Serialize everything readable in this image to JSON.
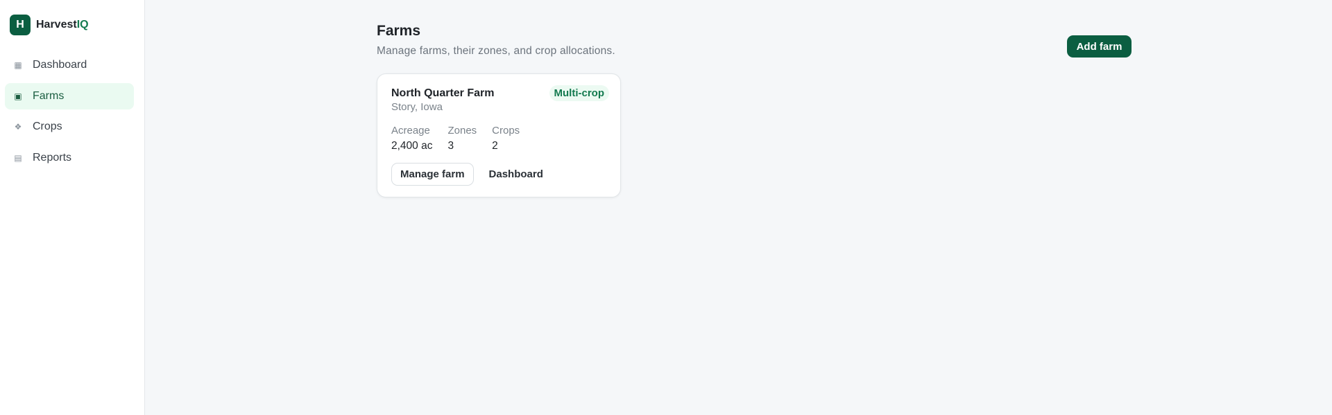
{
  "brand": {
    "logo_letter": "H",
    "name_main": "Harvest",
    "name_accent": "IQ",
    "color": "#0b5e41"
  },
  "sidebar": {
    "items": [
      {
        "label": "Dashboard",
        "icon": "grid-icon",
        "active": false
      },
      {
        "label": "Farms",
        "icon": "square-icon",
        "active": true
      },
      {
        "label": "Crops",
        "icon": "diamond-cluster-icon",
        "active": false
      },
      {
        "label": "Reports",
        "icon": "list-icon",
        "active": false
      }
    ]
  },
  "page": {
    "title": "Farms",
    "subtitle": "Manage farms, their zones, and crop allocations.",
    "add_button": "Add farm"
  },
  "farms": [
    {
      "name": "North Quarter Farm",
      "location": "Story, Iowa",
      "badge": "Multi-crop",
      "stats": [
        {
          "label": "Acreage",
          "value": "2,400 ac"
        },
        {
          "label": "Zones",
          "value": "3"
        },
        {
          "label": "Crops",
          "value": "2"
        }
      ],
      "actions": {
        "manage": "Manage farm",
        "dashboard": "Dashboard"
      }
    }
  ],
  "colors": {
    "accent": "#0b5e41",
    "active_bg": "#eafaf1",
    "badge_bg": "#ecfaf2",
    "page_bg": "#f5f7f9"
  }
}
